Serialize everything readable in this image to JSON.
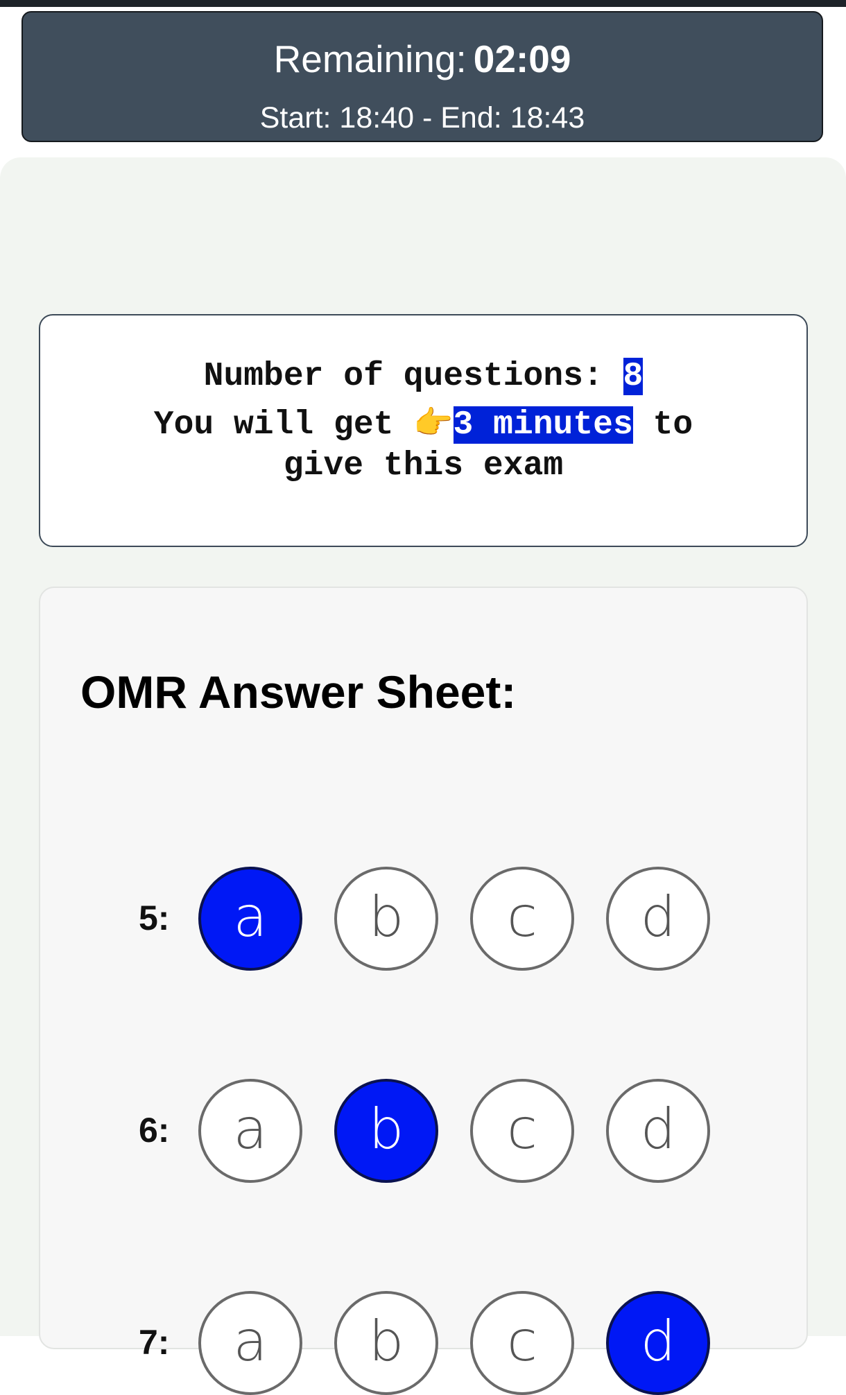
{
  "timer": {
    "remaining_label": "Remaining:",
    "remaining_value": "02:09",
    "time_range": "Start: 18:40 - End: 18:43"
  },
  "info": {
    "questions_label": "Number of questions: ",
    "questions_count": "8",
    "duration_prefix": "You will get ",
    "duration_icon": "pointing-hand-icon",
    "duration_value": "3 minutes",
    "duration_suffix": " to",
    "duration_line2": "give this exam",
    "highlight_color": "#0022d8"
  },
  "omr": {
    "title": "OMR Answer Sheet:",
    "selected_color": "#0018f5",
    "questions": [
      {
        "number": "5:",
        "options": [
          "a",
          "b",
          "c",
          "d"
        ],
        "selected": "a"
      },
      {
        "number": "6:",
        "options": [
          "a",
          "b",
          "c",
          "d"
        ],
        "selected": "b"
      },
      {
        "number": "7:",
        "options": [
          "a",
          "b",
          "c",
          "d"
        ],
        "selected": "d"
      }
    ]
  }
}
